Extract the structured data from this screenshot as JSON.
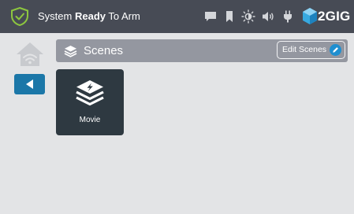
{
  "status_bar": {
    "status_prefix": "System ",
    "status_bold": "Ready",
    "status_suffix": " To Arm",
    "brand": "2GIG",
    "icons": [
      "shield-check-icon",
      "message-icon",
      "bookmark-icon",
      "brightness-icon",
      "volume-icon",
      "plug-icon",
      "2gig-logo"
    ]
  },
  "nav": {
    "home_icon": "home-wifi-icon",
    "back_icon": "back-arrow-icon"
  },
  "scenes": {
    "title": "Scenes",
    "edit_label": "Edit Scenes",
    "items": [
      {
        "label": "Movie",
        "icon": "layers-lightning-icon"
      }
    ]
  },
  "colors": {
    "top_bar": "#474b55",
    "background": "#e3e4e6",
    "accent": "#1b77a8",
    "status_green": "#8dc63f",
    "tile": "#2e3941",
    "header_bar": "#9497a0"
  }
}
